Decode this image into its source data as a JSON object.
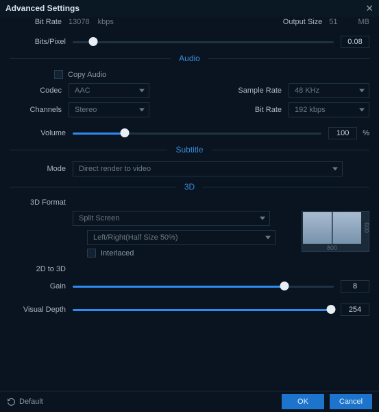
{
  "titlebar": {
    "title": "Advanced Settings"
  },
  "video": {
    "bitrate_label": "Bit Rate",
    "bitrate_value": "13078",
    "bitrate_unit": "kbps",
    "outputsize_label": "Output Size",
    "outputsize_value": "51",
    "outputsize_unit": "MB",
    "bitspixel_label": "Bits/Pixel",
    "bitspixel_value": "0.08",
    "bitspixel_pct": 8
  },
  "audio": {
    "heading": "Audio",
    "copy_label": "Copy Audio",
    "codec_label": "Codec",
    "codec_value": "AAC",
    "samplerate_label": "Sample Rate",
    "samplerate_value": "48 KHz",
    "channels_label": "Channels",
    "channels_value": "Stereo",
    "bitrate_label": "Bit Rate",
    "bitrate_value": "192 kbps",
    "volume_label": "Volume",
    "volume_value": "100",
    "volume_unit": "%",
    "volume_pct": 21
  },
  "subtitle": {
    "heading": "Subtitle",
    "mode_label": "Mode",
    "mode_value": "Direct render to video"
  },
  "threed": {
    "heading": "3D",
    "format_label": "3D Format",
    "format_value": "Split Screen",
    "sub_value": "Left/Right(Half Size 50%)",
    "interlaced_label": "Interlaced",
    "to3d_label": "2D to 3D",
    "gain_label": "Gain",
    "gain_value": "8",
    "gain_pct": 81,
    "depth_label": "Visual Depth",
    "depth_value": "254",
    "depth_pct": 99,
    "preview_w": "800",
    "preview_h": "600"
  },
  "footer": {
    "default_label": "Default",
    "ok_label": "OK",
    "cancel_label": "Cancel"
  }
}
